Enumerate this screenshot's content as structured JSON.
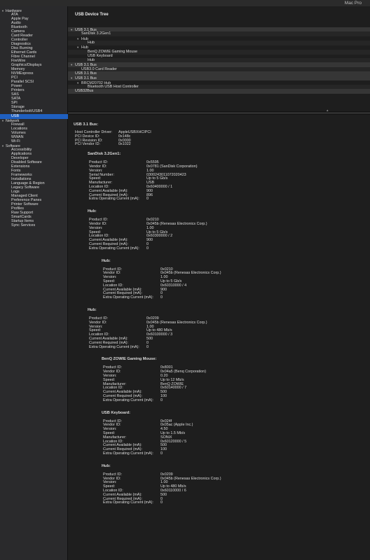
{
  "window": {
    "title": "Mac Pro"
  },
  "sidebar": [
    {
      "label": "Hardware",
      "kind": "cat",
      "open": true
    },
    {
      "label": "ATA"
    },
    {
      "label": "Apple Pay"
    },
    {
      "label": "Audio"
    },
    {
      "label": "Bluetooth"
    },
    {
      "label": "Camera"
    },
    {
      "label": "Card Reader"
    },
    {
      "label": "Controller"
    },
    {
      "label": "Diagnostics"
    },
    {
      "label": "Disc Burning"
    },
    {
      "label": "Ethernet Cards"
    },
    {
      "label": "Fibre Channel"
    },
    {
      "label": "FireWire"
    },
    {
      "label": "Graphics/Displays"
    },
    {
      "label": "Memory"
    },
    {
      "label": "NVMExpress"
    },
    {
      "label": "PCI"
    },
    {
      "label": "Parallel SCSI"
    },
    {
      "label": "Power"
    },
    {
      "label": "Printers"
    },
    {
      "label": "SAS"
    },
    {
      "label": "SATA"
    },
    {
      "label": "SPI"
    },
    {
      "label": "Storage"
    },
    {
      "label": "Thunderbolt/USB4"
    },
    {
      "label": "USB",
      "selected": true
    },
    {
      "label": "Network",
      "kind": "cat",
      "open": true
    },
    {
      "label": "Firewall"
    },
    {
      "label": "Locations"
    },
    {
      "label": "Volumes"
    },
    {
      "label": "WWAN"
    },
    {
      "label": "Wi-Fi"
    },
    {
      "label": "Software",
      "kind": "cat",
      "open": true
    },
    {
      "label": "Accessibility"
    },
    {
      "label": "Applications"
    },
    {
      "label": "Developer"
    },
    {
      "label": "Disabled Software"
    },
    {
      "label": "Extensions"
    },
    {
      "label": "Fonts"
    },
    {
      "label": "Frameworks"
    },
    {
      "label": "Installations"
    },
    {
      "label": "Language & Region"
    },
    {
      "label": "Legacy Software"
    },
    {
      "label": "Logs"
    },
    {
      "label": "Managed Client"
    },
    {
      "label": "Preference Panes"
    },
    {
      "label": "Printer Software"
    },
    {
      "label": "Profiles"
    },
    {
      "label": "Raw Support"
    },
    {
      "label": "SmartCards"
    },
    {
      "label": "Startup Items"
    },
    {
      "label": "Sync Services"
    }
  ],
  "tree": {
    "heading": "USB Device Tree",
    "rows": [
      {
        "label": "USB 3.1 Bus",
        "level": 0,
        "tri": "open",
        "bus": true
      },
      {
        "label": "SanDisk 3.2Gen1",
        "level": 1
      },
      {
        "label": "Hub",
        "level": 1,
        "tri": "open"
      },
      {
        "label": "Hub",
        "level": 2
      },
      {
        "label": "Hub",
        "level": 1,
        "tri": "open"
      },
      {
        "label": "BenQ ZOWIE Gaming Mouse",
        "level": 2
      },
      {
        "label": "USB Keyboard",
        "level": 2
      },
      {
        "label": "Hub",
        "level": 2
      },
      {
        "label": "USB 3.1 Bus",
        "level": 0,
        "tri": "open",
        "bus": true
      },
      {
        "label": "USB3.0 Card Reader",
        "level": 1
      },
      {
        "label": "USB 3.1 Bus",
        "level": 0,
        "bus": true
      },
      {
        "label": "USB 3.1 Bus",
        "level": 0,
        "tri": "open",
        "bus": true
      },
      {
        "label": "BRCM20702 Hub",
        "level": 1,
        "tri": "open"
      },
      {
        "label": "Bluetooth USB Host Controller",
        "level": 2
      },
      {
        "label": "USB32Bus",
        "level": 0,
        "bus": true
      }
    ]
  },
  "detail": {
    "heading": "USB 3.1 Bus:",
    "bus_info": [
      {
        "k": "Host Controller Driver:",
        "v": "AppleUSBXHCIPCI"
      },
      {
        "k": "PCI Device ID:",
        "v": "0x148c"
      },
      {
        "k": "PCI Revision ID:",
        "v": "0x0000"
      },
      {
        "k": "PCI Vendor ID:",
        "v": "0x1022"
      }
    ],
    "devices": [
      {
        "name": "SanDisk 3.2Gen1:",
        "indent": 1,
        "fields": [
          {
            "k": "Product ID:",
            "v": "0x5595"
          },
          {
            "k": "Vendor ID:",
            "v": "0x0781  (SanDisk Corporation)"
          },
          {
            "k": "Version:",
            "v": "1.00"
          },
          {
            "k": "Serial Number:",
            "v": "0300243011072020423"
          },
          {
            "k": "Speed:",
            "v": "Up to 5 Gb/s"
          },
          {
            "k": "Manufacturer:",
            "v": "USB"
          },
          {
            "k": "Location ID:",
            "v": "0x60400000 / 1"
          },
          {
            "k": "Current Available (mA):",
            "v": "900"
          },
          {
            "k": "Current Required (mA):",
            "v": "896"
          },
          {
            "k": "Extra Operating Current (mA):",
            "v": "0"
          }
        ]
      },
      {
        "name": "Hub:",
        "indent": 1,
        "fields": [
          {
            "k": "Product ID:",
            "v": "0x0210"
          },
          {
            "k": "Vendor ID:",
            "v": "0x045b  (Renesas Electronics Corp.)"
          },
          {
            "k": "Version:",
            "v": "1.00"
          },
          {
            "k": "Speed:",
            "v": "Up to 5 Gb/s"
          },
          {
            "k": "Location ID:",
            "v": "0x60300000 / 2"
          },
          {
            "k": "Current Available (mA):",
            "v": "900"
          },
          {
            "k": "Current Required (mA):",
            "v": "0"
          },
          {
            "k": "Extra Operating Current (mA):",
            "v": "0"
          }
        ]
      },
      {
        "name": "Hub:",
        "indent": 2,
        "fields": [
          {
            "k": "Product ID:",
            "v": "0x0210"
          },
          {
            "k": "Vendor ID:",
            "v": "0x045b  (Renesas Electronics Corp.)"
          },
          {
            "k": "Version:",
            "v": "1.00"
          },
          {
            "k": "Speed:",
            "v": "Up to 5 Gb/s"
          },
          {
            "k": "Location ID:",
            "v": "0x60310000 / 4"
          },
          {
            "k": "Current Available (mA):",
            "v": "900"
          },
          {
            "k": "Current Required (mA):",
            "v": "0"
          },
          {
            "k": "Extra Operating Current (mA):",
            "v": "0"
          }
        ]
      },
      {
        "name": "Hub:",
        "indent": 1,
        "fields": [
          {
            "k": "Product ID:",
            "v": "0x0209"
          },
          {
            "k": "Vendor ID:",
            "v": "0x045b  (Renesas Electronics Corp.)"
          },
          {
            "k": "Version:",
            "v": "1.00"
          },
          {
            "k": "Speed:",
            "v": "Up to 480 Mb/s"
          },
          {
            "k": "Location ID:",
            "v": "0x60100000 / 3"
          },
          {
            "k": "Current Available (mA):",
            "v": "500"
          },
          {
            "k": "Current Required (mA):",
            "v": "0"
          },
          {
            "k": "Extra Operating Current (mA):",
            "v": "0"
          }
        ]
      },
      {
        "name": "BenQ ZOWIE Gaming Mouse:",
        "indent": 2,
        "fields": [
          {
            "k": "Product ID:",
            "v": "0x8001"
          },
          {
            "k": "Vendor ID:",
            "v": "0x04a5  (Benq Corporation)"
          },
          {
            "k": "Version:",
            "v": "0.20"
          },
          {
            "k": "Speed:",
            "v": "Up to 12 Mb/s"
          },
          {
            "k": "Manufacturer:",
            "v": "BenQ ZOWIE"
          },
          {
            "k": "Location ID:",
            "v": "0x60140000 / 7"
          },
          {
            "k": "Current Available (mA):",
            "v": "500"
          },
          {
            "k": "Current Required (mA):",
            "v": "100"
          },
          {
            "k": "Extra Operating Current (mA):",
            "v": "0"
          }
        ]
      },
      {
        "name": "USB Keyboard:",
        "indent": 2,
        "fields": [
          {
            "k": "Product ID:",
            "v": "0x024f"
          },
          {
            "k": "Vendor ID:",
            "v": "0x05ac  (Apple Inc.)"
          },
          {
            "k": "Version:",
            "v": "4.50"
          },
          {
            "k": "Speed:",
            "v": "Up to 1.5 Mb/s"
          },
          {
            "k": "Manufacturer:",
            "v": "SONiX"
          },
          {
            "k": "Location ID:",
            "v": "0x60120000 / 5"
          },
          {
            "k": "Current Available (mA):",
            "v": "500"
          },
          {
            "k": "Current Required (mA):",
            "v": "100"
          },
          {
            "k": "Extra Operating Current (mA):",
            "v": "0"
          }
        ]
      },
      {
        "name": "Hub:",
        "indent": 2,
        "fields": [
          {
            "k": "Product ID:",
            "v": "0x0209"
          },
          {
            "k": "Vendor ID:",
            "v": "0x045b  (Renesas Electronics Corp.)"
          },
          {
            "k": "Version:",
            "v": "1.00"
          },
          {
            "k": "Speed:",
            "v": "Up to 480 Mb/s"
          },
          {
            "k": "Location ID:",
            "v": "0x60110000 / 6"
          },
          {
            "k": "Current Available (mA):",
            "v": "500"
          },
          {
            "k": "Current Required (mA):",
            "v": "0"
          },
          {
            "k": "Extra Operating Current (mA):",
            "v": "0"
          }
        ]
      }
    ]
  }
}
